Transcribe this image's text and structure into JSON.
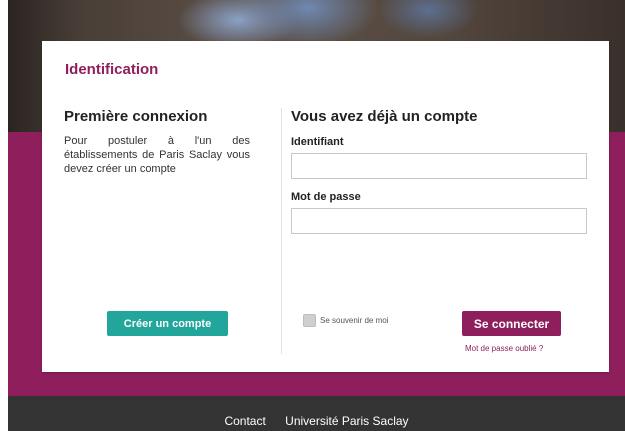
{
  "card": {
    "title": "Identification"
  },
  "left": {
    "heading": "Première connexion",
    "text": "Pour postuler à l'un des établissements de Paris Saclay vous devez créer un compte",
    "create_button": "Créer un compte"
  },
  "right": {
    "heading": "Vous avez déjà un compte",
    "identifier_label": "Identifiant",
    "identifier_value": "",
    "password_label": "Mot de passe",
    "password_value": "",
    "remember_label": "Se souvenir de moi",
    "remember_checked": false,
    "connect_button": "Se connecter",
    "forgot_link": "Mot de passe oublié ?"
  },
  "footer": {
    "links": [
      "Contact",
      "Université Paris Saclay"
    ]
  },
  "colors": {
    "brand_purple": "#8e1f5c",
    "create_teal": "#22a59a",
    "footer_dark": "#333333"
  }
}
